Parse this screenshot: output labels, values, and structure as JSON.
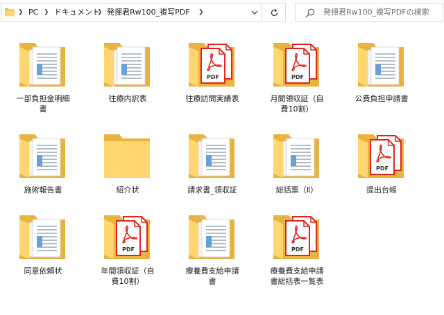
{
  "address": {
    "crumbs": [
      "PC",
      "ドキュメント",
      "発揮君Rw100_複写PDF"
    ]
  },
  "search": {
    "placeholder": "発揮君Rw100_複写PDFの検索"
  },
  "items": [
    {
      "label": "一部負担金明細\n書",
      "type": "folder-docs"
    },
    {
      "label": "往療内訳表",
      "type": "folder-docs"
    },
    {
      "label": "往療訪問実績表",
      "type": "folder-pdf"
    },
    {
      "label": "月間領収証（自\n費10割）",
      "type": "folder-pdf"
    },
    {
      "label": "公費負担申請書",
      "type": "folder-docs"
    },
    {
      "label": "施術報告書",
      "type": "folder-docs"
    },
    {
      "label": "紹介状",
      "type": "folder-empty"
    },
    {
      "label": "請求書_領収証",
      "type": "folder-docs"
    },
    {
      "label": "総括票（Ⅱ）",
      "type": "folder-docs"
    },
    {
      "label": "提出台帳",
      "type": "folder-pdf"
    },
    {
      "label": "同意依頼状",
      "type": "folder-docs"
    },
    {
      "label": "年間領収証（自\n費10割）",
      "type": "folder-pdf"
    },
    {
      "label": "療養費支給申請\n書",
      "type": "folder-docs"
    },
    {
      "label": "療養費支給申請\n書総括表一覧表",
      "type": "folder-pdf"
    }
  ],
  "colors": {
    "folder_back": "#e8b33f",
    "folder_front": "#ffd76e",
    "pdf_red": "#e0231b"
  }
}
